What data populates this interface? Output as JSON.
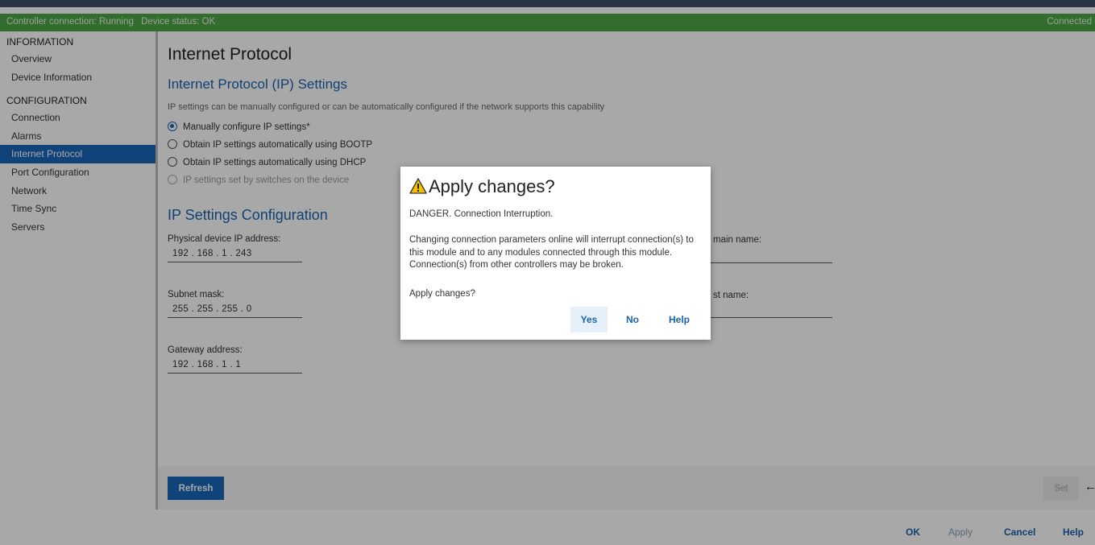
{
  "status_bar": {
    "controller": "Controller connection: Running",
    "device": "Device status: OK",
    "right": "Connected"
  },
  "sidebar": {
    "section_information": "INFORMATION",
    "information_items": [
      "Overview",
      "Device Information"
    ],
    "section_configuration": "CONFIGURATION",
    "configuration_items": [
      "Connection",
      "Alarms",
      "Internet Protocol",
      "Port Configuration",
      "Network",
      "Time Sync",
      "Servers"
    ],
    "active_item": "Internet Protocol"
  },
  "main": {
    "title": "Internet Protocol",
    "ip_settings_title": "Internet Protocol (IP) Settings",
    "ip_settings_desc": "IP settings can be manually configured or can be automatically configured if the network supports this capability",
    "radio_options": [
      {
        "label": "Manually configure IP settings*",
        "checked": true,
        "disabled": false
      },
      {
        "label": "Obtain IP settings automatically using BOOTP",
        "checked": false,
        "disabled": false
      },
      {
        "label": "Obtain IP settings automatically using DHCP",
        "checked": false,
        "disabled": false
      },
      {
        "label": "IP settings set by switches on the device",
        "checked": false,
        "disabled": true
      }
    ],
    "config_title": "IP Settings Configuration",
    "fields": {
      "ip_label": "Physical device IP address:",
      "ip_value": "192 . 168 .  1  . 243",
      "subnet_label": "Subnet mask:",
      "subnet_value": "255 . 255 . 255 .  0",
      "gateway_label": "Gateway address:",
      "gateway_value": "192 . 168 .  1  .  1",
      "domain_label_partial": "main name:",
      "host_label_partial": "st name:"
    }
  },
  "action_bar": {
    "refresh": "Refresh",
    "set": "Set",
    "arrow": "←"
  },
  "footer": {
    "ok": "OK",
    "apply": "Apply",
    "cancel": "Cancel",
    "help": "Help"
  },
  "dialog": {
    "title": "Apply changes?",
    "icon": "warning-icon",
    "danger_line": "DANGER. Connection Interruption.",
    "body": "Changing connection parameters online will interrupt connection(s) to this module and to any modules connected through this module. Connection(s) from other controllers may be broken.",
    "question": "Apply changes?",
    "yes": "Yes",
    "no": "No",
    "help": "Help"
  },
  "colors": {
    "status_green": "#4ea646",
    "accent_blue": "#1767b8",
    "warning_yellow": "#f2c200"
  }
}
